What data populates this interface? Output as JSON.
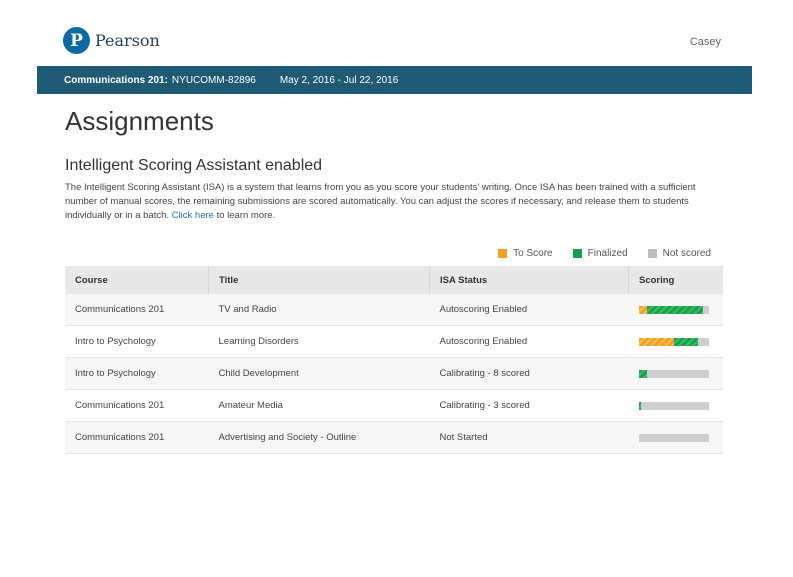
{
  "header": {
    "logo_letter": "P",
    "logo_text": "Pearson",
    "user_name": "Casey"
  },
  "course_bar": {
    "course_name": "Communications 201:",
    "course_code": "NYUCOMM-82896",
    "dates": "May 2, 2016  -  Jul 22, 2016"
  },
  "page": {
    "title": "Assignments",
    "section_title": "Intelligent Scoring Assistant enabled",
    "description": "The Intelligent Scoring Assistant (ISA) is a system that learns from you as you score your students' writing. Once ISA has been trained with a sufficient number of manual scores, the remaining submissions are scored automatically. You can adjust the scores if necessary, and release them to students individually or in a batch.",
    "link_text": "Click here",
    "link_suffix": " to learn more."
  },
  "legend": {
    "items": [
      {
        "label": "To Score",
        "color": "#f0a020"
      },
      {
        "label": "Finalized",
        "color": "#18a04a"
      },
      {
        "label": "Not scored",
        "color": "#bdbdbd"
      }
    ]
  },
  "table": {
    "columns": [
      "Course",
      "Title",
      "ISA Status",
      "Scoring"
    ],
    "rows": [
      {
        "course": "Communications 201",
        "title": "TV and Radio",
        "status": "Autoscoring Enabled",
        "to_score": 0.12,
        "finalized": 0.8
      },
      {
        "course": "Intro to Psychology",
        "title": "Learning Disorders",
        "status": "Autoscoring Enabled",
        "to_score": 0.5,
        "finalized": 0.35
      },
      {
        "course": "Intro to Psychology",
        "title": "Child Development",
        "status": "Calibrating - 8 scored",
        "to_score": 0.0,
        "finalized": 0.12
      },
      {
        "course": "Communications 201",
        "title": "Amateur Media",
        "status": "Calibrating - 3 scored",
        "to_score": 0.0,
        "finalized": 0.03
      },
      {
        "course": "Communications 201",
        "title": "Advertising and Society - Outline",
        "status": "Not Started",
        "to_score": 0.0,
        "finalized": 0.0
      }
    ]
  }
}
